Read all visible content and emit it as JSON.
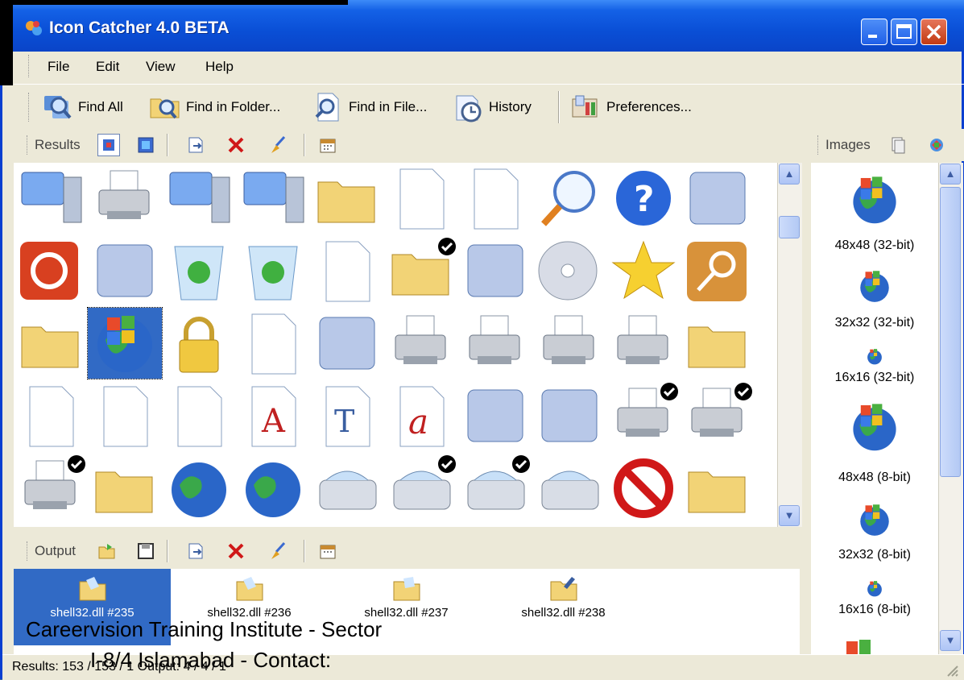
{
  "window": {
    "title": "Icon Catcher 4.0 BETA"
  },
  "menu": [
    "File",
    "Edit",
    "View",
    "Help"
  ],
  "toolbar": {
    "find_all": "Find All",
    "find_in_folder": "Find in Folder...",
    "find_in_file": "Find in File...",
    "history": "History",
    "preferences": "Preferences..."
  },
  "results_pane": {
    "label": "Results"
  },
  "images_pane": {
    "label": "Images",
    "entries": [
      "48x48 (32-bit)",
      "32x32 (32-bit)",
      "16x16 (32-bit)",
      "48x48 (8-bit)",
      "32x32 (8-bit)",
      "16x16 (8-bit)"
    ]
  },
  "output_pane": {
    "label": "Output",
    "items": [
      "shell32.dll #235",
      "shell32.dll #236",
      "shell32.dll #237",
      "shell32.dll #238"
    ]
  },
  "status": {
    "text": "Results: 153 / 153 / 1   Output: 4 / 4 / 1"
  },
  "watermark": {
    "line1": "Careervision Training Institute - Sector",
    "line2": "I-8/4 Islamabad - Contact:"
  },
  "colors": {
    "title_bar": "#0a4fd6",
    "selection": "#316ac5",
    "close_button": "#c23a12",
    "window_frame": "#ece9d8"
  }
}
